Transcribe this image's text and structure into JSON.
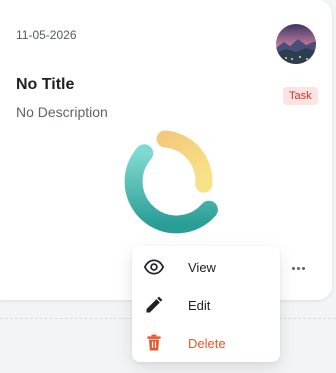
{
  "card": {
    "date": "11-05-2026",
    "title": "No Title",
    "description": "No Description",
    "tag": "Task",
    "tag_color": "#c0392b",
    "tag_background": "#fde3e1",
    "progress_icon": "donut-progress-icon",
    "avatar_icon": "landscape-avatar-icon",
    "more_icon": "more-horizontal-icon"
  },
  "menu": {
    "items": [
      {
        "label": "View",
        "icon": "eye-icon"
      },
      {
        "label": "Edit",
        "icon": "pencil-icon"
      },
      {
        "label": "Delete",
        "icon": "trash-icon",
        "color": "#e8562a"
      }
    ]
  }
}
